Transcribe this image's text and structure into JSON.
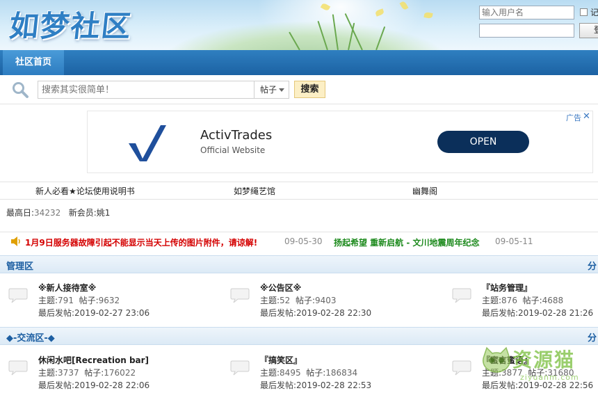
{
  "header": {
    "logo": "如梦社区",
    "username_placeholder": "输入用户名",
    "remember_label": "记",
    "login_button": "登"
  },
  "nav": {
    "home_tab": "社区首页"
  },
  "search": {
    "placeholder": "搜索其实很简单！",
    "type": "帖子",
    "button": "搜索"
  },
  "ad": {
    "title": "ActivTrades",
    "subtitle": "Official Website",
    "cta": "OPEN",
    "label": "广告",
    "close": "✕",
    "brand_color": "#0b2f5a",
    "logo_color": "#1f4f9c"
  },
  "links": [
    "新人必看★论坛使用说明书",
    "如梦绳艺馆",
    "幽舞阁"
  ],
  "stats": {
    "max_label": "最高日:",
    "max_value": "34232",
    "newest_label": "新会员:",
    "newest_value": "姚1"
  },
  "announcements": [
    {
      "text": "1月9日服务器故障引起不能显示当天上传的图片附件，请谅解!",
      "date": "09-05-30",
      "color": "#d40000"
    },
    {
      "text": "扬起希望 重新启航 - 文川地震周年纪念",
      "date": "09-05-11",
      "color": "#1d8a1d"
    }
  ],
  "categories": [
    {
      "title": "管理区",
      "right": "分",
      "forums": [
        {
          "name": "※新人接待室※",
          "topics_label": "主题:",
          "topics": "791",
          "posts_label": "帖子:",
          "posts": "9632",
          "last_label": "最后发帖:",
          "last": "2019-02-27 23:06"
        },
        {
          "name": "※公告区※",
          "topics_label": "主题:",
          "topics": "52",
          "posts_label": "帖子:",
          "posts": "9403",
          "last_label": "最后发帖:",
          "last": "2019-02-28 22:30"
        },
        {
          "name": "『站务管理』",
          "topics_label": "主题:",
          "topics": "876",
          "posts_label": "帖子:",
          "posts": "4688",
          "last_label": "最后发帖:",
          "last": "2019-02-28 21:26"
        }
      ]
    },
    {
      "title": "◆-交流区-◆",
      "right": "分",
      "forums": [
        {
          "name": "休闲水吧[Recreation bar]",
          "topics_label": "主题:",
          "topics": "3737",
          "posts_label": "帖子:",
          "posts": "176022",
          "last_label": "最后发帖:",
          "last": "2019-02-28 22:06"
        },
        {
          "name": "『搞笑区』",
          "topics_label": "主题:",
          "topics": "8495",
          "posts_label": "帖子:",
          "posts": "186834",
          "last_label": "最后发帖:",
          "last": "2019-02-28 22:53"
        },
        {
          "name": "『蜜言蜜语』",
          "topics_label": "主题:",
          "topics": "3877",
          "posts_label": "帖子:",
          "posts": "31680",
          "last_label": "最后发帖:",
          "last": "2019-02-28 22:56"
        }
      ]
    }
  ],
  "watermark": {
    "text": "资源猫",
    "sub": "ziyuanm.com"
  },
  "colors": {
    "nav_blue": "#1c62a3",
    "category_title": "#1d5fa2",
    "announce_red": "#d40000",
    "announce_green": "#1d8a1d",
    "search_button_bg": "#fcefc5"
  }
}
